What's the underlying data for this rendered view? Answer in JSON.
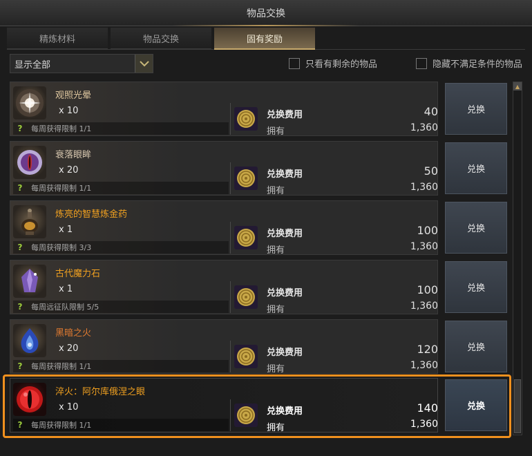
{
  "window": {
    "title": "物品交换"
  },
  "tabs": [
    {
      "label": "精炼材料",
      "active": false
    },
    {
      "label": "物品交换",
      "active": false
    },
    {
      "label": "固有奖励",
      "active": true
    }
  ],
  "filter": {
    "select_value": "显示全部",
    "check1_label": "只看有剩余的物品",
    "check2_label": "隐藏不满足条件的物品"
  },
  "items": [
    {
      "name": "观照光晕",
      "name_color": "#e0c8a0",
      "qty": "x 10",
      "limit": "每周获得限制 1/1",
      "cost_label": "兑换费用",
      "cost": "40",
      "own_label": "拥有",
      "own": "1,360",
      "button": "兑换",
      "icon": "halo-orb-icon"
    },
    {
      "name": "衰落眼眸",
      "name_color": "#d8c8b0",
      "qty": "x 20",
      "limit": "每周获得限制 1/1",
      "cost_label": "兑换费用",
      "cost": "50",
      "own_label": "拥有",
      "own": "1,360",
      "button": "兑换",
      "icon": "purple-eye-icon"
    },
    {
      "name": "炼亮的智慧炼金药",
      "name_color": "#f0a020",
      "qty": "x 1",
      "limit": "每周获得限制 3/3",
      "cost_label": "兑换费用",
      "cost": "100",
      "own_label": "拥有",
      "own": "1,360",
      "button": "兑换",
      "icon": "elixir-bottle-icon"
    },
    {
      "name": "古代魔力石",
      "name_color": "#f0a020",
      "qty": "x 1",
      "limit": "每周远征队限制 5/5",
      "cost_label": "兑换费用",
      "cost": "100",
      "own_label": "拥有",
      "own": "1,360",
      "button": "兑换",
      "icon": "magic-crystal-icon"
    },
    {
      "name": "黑暗之火",
      "name_color": "#e07a30",
      "qty": "x 20",
      "limit": "每周获得限制 1/1",
      "cost_label": "兑换费用",
      "cost": "120",
      "own_label": "拥有",
      "own": "1,360",
      "button": "兑换",
      "icon": "dark-flame-icon"
    },
    {
      "name": "淬火：阿尔库俄涅之眼",
      "name_color": "#f0a020",
      "qty": "x 10",
      "limit": "每周获得限制 1/1",
      "cost_label": "兑换费用",
      "cost": "140",
      "own_label": "拥有",
      "own": "1,360",
      "button": "兑换",
      "icon": "red-eye-icon"
    }
  ],
  "colors": {
    "accent_gold": "#c8aa6c",
    "selection_orange": "#f0901e",
    "limit_check_green": "#9ccc3c"
  }
}
